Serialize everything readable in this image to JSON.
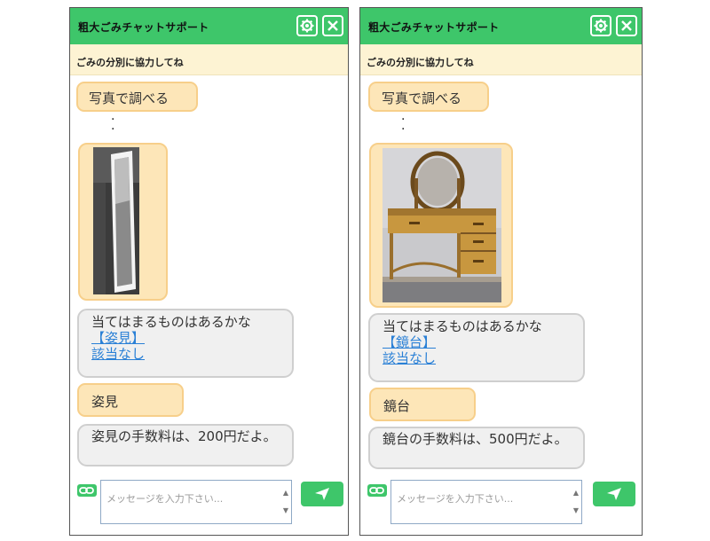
{
  "app": {
    "title": "粗大ごみチャットサポート",
    "subtitle": "ごみの分別に協力してね"
  },
  "panels": [
    {
      "user_query": "写真で調べる",
      "photo_icon": "mirror-photo",
      "bot_question": "当てはまるものはあるかな",
      "options": [
        "【姿見】",
        "該当なし"
      ],
      "user_choice": "姿見",
      "bot_answer": "姿見の手数料は、200円だよ。",
      "input_placeholder": "メッセージを入力下さい..."
    },
    {
      "user_query": "写真で調べる",
      "photo_icon": "dresser-photo",
      "bot_question": "当てはまるものはあるかな",
      "options": [
        "【鏡台】",
        "該当なし"
      ],
      "user_choice": "鏡台",
      "bot_answer": "鏡台の手数料は、500円だよ。",
      "input_placeholder": "メッセージを入力下さい..."
    }
  ],
  "colors": {
    "header": "#3ec66a",
    "subheader": "#fdf3d3",
    "user_bubble": "#fde6b8",
    "bot_bubble": "#f0f0f0",
    "link": "#2a80d6"
  }
}
